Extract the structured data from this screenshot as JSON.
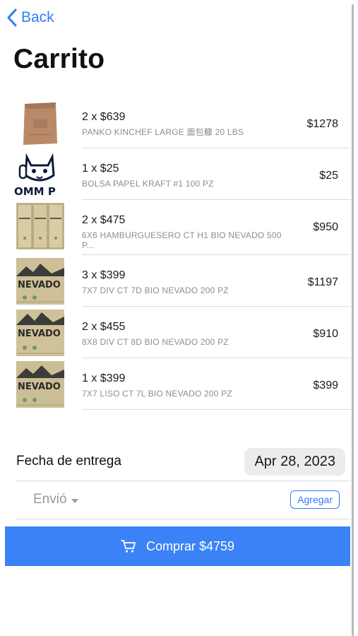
{
  "nav": {
    "back_label": "Back"
  },
  "page": {
    "title": "Carrito"
  },
  "cart": {
    "items": [
      {
        "qty_price": "2 x $639",
        "description": "PANKO KINCHEF LARGE 面包糠 20 LBS",
        "total": "$1278",
        "thumbnail": "brown-paper-sack"
      },
      {
        "qty_price": "1 x $25",
        "description": "BOLSA PAPEL KRAFT #1 100 PZ",
        "total": "$25",
        "thumbnail": "lucky-cat-logo"
      },
      {
        "qty_price": "2 x $475",
        "description": "6X6 HAMBURGUESERO CT H1 BIO NEVADO 500 P...",
        "total": "$950",
        "thumbnail": "nevado-box-stack"
      },
      {
        "qty_price": "3 x $399",
        "description": "7X7 DIV CT 7D BIO NEVADO 200 PZ",
        "total": "$1197",
        "thumbnail": "nevado-box"
      },
      {
        "qty_price": "2 x $455",
        "description": "8X8 DIV CT 8D BIO NEVADO 200 PZ",
        "total": "$910",
        "thumbnail": "nevado-box"
      },
      {
        "qty_price": "1 x $399",
        "description": "7X7 LISO CT 7L BIO NEVADO 200 PZ",
        "total": "$399",
        "thumbnail": "nevado-box"
      }
    ],
    "thumb_logo_text": "OMM P",
    "thumb_brand_text": "NEVADO"
  },
  "delivery": {
    "label": "Fecha de entrega",
    "date": "Apr 28, 2023"
  },
  "shipping": {
    "select_label": "Envió",
    "add_label": "Agregar"
  },
  "checkout": {
    "buy_label": "Comprar $4759"
  },
  "colors": {
    "accent": "#2f7cf6",
    "buy_button": "#3b82f6"
  }
}
